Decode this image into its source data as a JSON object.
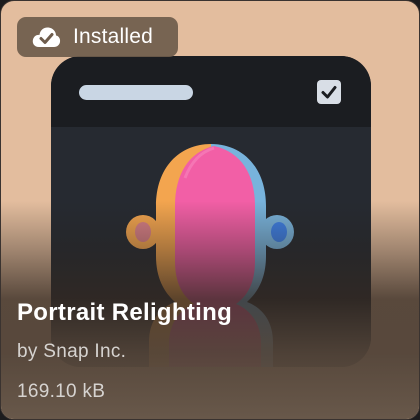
{
  "lens_card": {
    "badge": {
      "icon": "cloud-check-icon",
      "label": "Installed"
    },
    "preview": {
      "icon": "portrait-relighting-icon",
      "colors": {
        "face_pink": "#f25fa6",
        "left_orange": "#f3a54f",
        "right_blue": "#78b3dc",
        "card_bg": "#e3bd9e"
      }
    },
    "title": "Portrait Relighting",
    "author": "by Snap Inc.",
    "file_size": "169.10 kB"
  }
}
